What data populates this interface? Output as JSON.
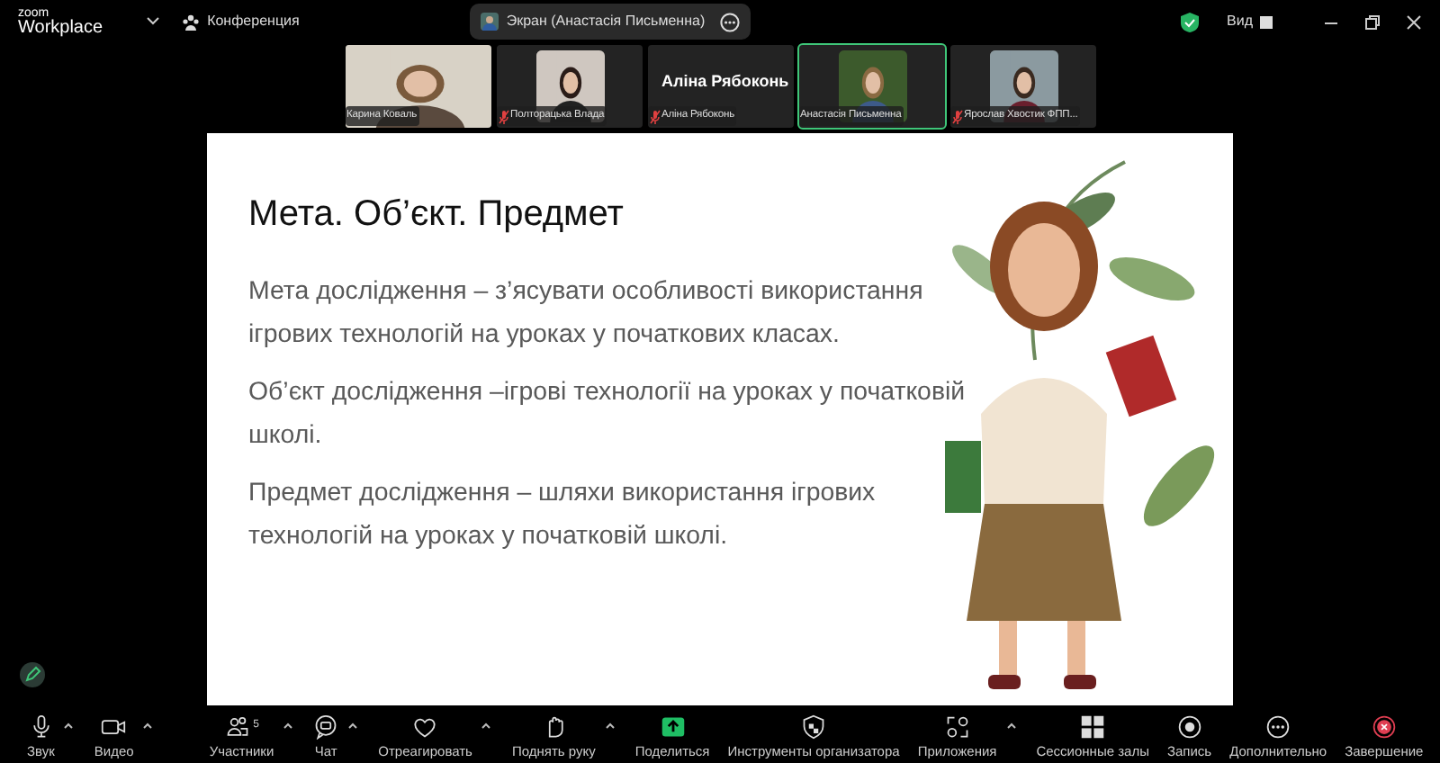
{
  "top_bar": {
    "logo_small": "zoom",
    "logo_big": "Workplace",
    "meeting_label": "Конференция",
    "share_label": "Экран (Анастасія Письменна)",
    "view_label": "Вид"
  },
  "participants": [
    {
      "name": "Карина Коваль",
      "kind": "video",
      "muted": false,
      "speaking": false
    },
    {
      "name": "Полторацька Влада",
      "kind": "avatar",
      "muted": true,
      "speaking": false
    },
    {
      "name": "Аліна Рябоконь",
      "big_name": "Аліна Рябоконь",
      "kind": "name",
      "muted": true,
      "speaking": false
    },
    {
      "name": "Анастасія Письменна",
      "kind": "avatar",
      "muted": false,
      "speaking": true
    },
    {
      "name": "Ярослав Хвостик ФПП...",
      "kind": "avatar",
      "muted": true,
      "speaking": false
    }
  ],
  "slide": {
    "title": "Мета. Об’єкт. Предмет",
    "paragraphs": [
      "Мета дослідження – з’ясувати особливості використання ігрових технологій на уроках у початкових класах.",
      "Об’єкт дослідження –ігрові технології на уроках у початковій школі.",
      "Предмет дослідження – шляхи використання ігрових технологій на уроках у початковій школі."
    ]
  },
  "toolbar": [
    {
      "label": "Звук",
      "caret": true
    },
    {
      "label": "Видео",
      "caret": true
    },
    {
      "label": "Участники",
      "count": "5",
      "caret": true
    },
    {
      "label": "Чат",
      "caret": true
    },
    {
      "label": "Отреагировать",
      "caret": true
    },
    {
      "label": "Поднять руку",
      "caret": true
    },
    {
      "label": "Поделиться",
      "caret": false
    },
    {
      "label": "Инструменты организатора",
      "caret": false
    },
    {
      "label": "Приложения",
      "caret": true
    },
    {
      "label": "Сессионные залы",
      "caret": false
    },
    {
      "label": "Запись",
      "caret": false
    },
    {
      "label": "Дополнительно",
      "caret": false
    },
    {
      "label": "Завершение",
      "caret": false
    }
  ]
}
